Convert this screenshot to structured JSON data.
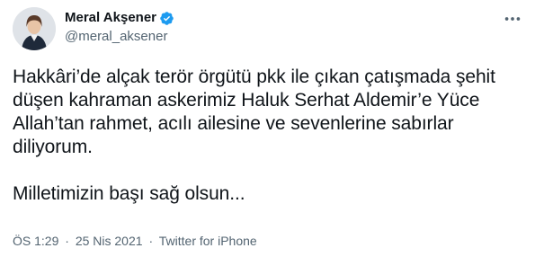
{
  "user": {
    "display_name": "Meral Akşener",
    "handle": "@meral_aksener",
    "verified": true
  },
  "tweet": {
    "paragraph_1": "Hakkâri’de alçak terör örgütü pkk ile çıkan çatışmada şehit düşen kahraman askerimiz Haluk Serhat Aldemir’e Yüce Allah’tan rahmet, acılı ailesine ve sevenlerine sabırlar diliyorum.",
    "paragraph_2": "Milletimizin başı sağ olsun..."
  },
  "meta": {
    "time": "ÖS 1:29",
    "separator": "·",
    "date": "25 Nis 2021",
    "source": "Twitter for iPhone"
  },
  "icons": {
    "verified": "verified-badge-icon",
    "more": "more-options-icon"
  },
  "colors": {
    "verified": "#1d9bf0",
    "text": "#0f1419",
    "secondary": "#536471"
  }
}
